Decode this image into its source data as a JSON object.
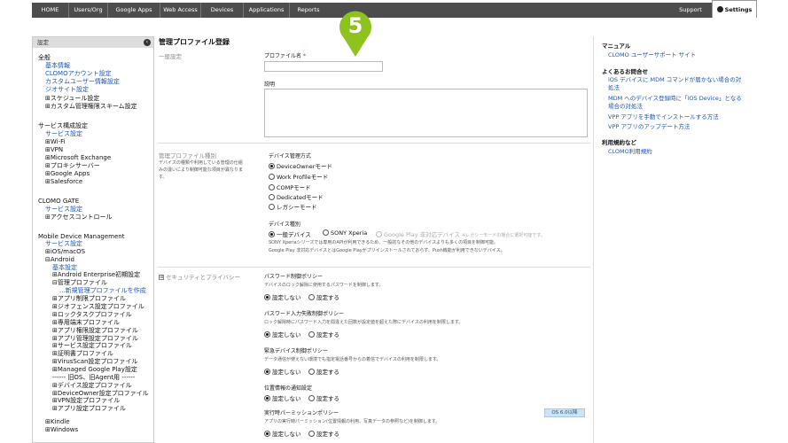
{
  "nav": {
    "items": [
      "HOME",
      "Users/Org",
      "Google Apps",
      "Web Access",
      "Devices",
      "Applications",
      "Reports"
    ],
    "support": "Support",
    "settings": "Settings"
  },
  "sidebar": {
    "header": "設定",
    "lines": [
      {
        "text": "全般",
        "kind": "sec"
      },
      {
        "text": "基本情報",
        "kind": "lnk"
      },
      {
        "text": "CLOMOアカウント設定",
        "kind": "lnk"
      },
      {
        "text": "カスタムユーザー情報設定",
        "kind": "lnk"
      },
      {
        "text": "ジオサイト設定",
        "kind": "lnk"
      },
      {
        "text": "⊞スケジュール設定",
        "kind": "plain"
      },
      {
        "text": "⊞カスタム管理権限スキーム設定",
        "kind": "plain"
      },
      {
        "text": "サービス構成設定",
        "kind": "sec"
      },
      {
        "text": "サービス設定",
        "kind": "lnk"
      },
      {
        "text": "⊞Wi-Fi",
        "kind": "plain"
      },
      {
        "text": "⊞VPN",
        "kind": "plain"
      },
      {
        "text": "⊞Microsoft Exchange",
        "kind": "plain"
      },
      {
        "text": "⊞プロキシサーバー",
        "kind": "plain"
      },
      {
        "text": "⊞Google Apps",
        "kind": "plain"
      },
      {
        "text": "⊞Salesforce",
        "kind": "plain"
      },
      {
        "text": "CLOMO GATE",
        "kind": "sec"
      },
      {
        "text": "サービス設定",
        "kind": "lnk"
      },
      {
        "text": "⊞アクセスコントロール",
        "kind": "plain"
      },
      {
        "text": "Mobile Device Management",
        "kind": "sec"
      },
      {
        "text": "サービス設定",
        "kind": "lnk"
      },
      {
        "text": "⊞iOS/macOS",
        "kind": "plain"
      },
      {
        "text": "⊟Android",
        "kind": "plain"
      },
      {
        "text": "基本設定",
        "kind": "lnk"
      },
      {
        "text": "⊞Android Enterprise初期設定",
        "kind": "plain"
      },
      {
        "text": "⊟管理プロファイル",
        "kind": "plain"
      },
      {
        "text": "...新規管理プロファイルを作成",
        "kind": "lnk"
      },
      {
        "text": "⊞アプリ制限プロファイル",
        "kind": "plain"
      },
      {
        "text": "⊞ジオフェンス設定プロファイル",
        "kind": "plain"
      },
      {
        "text": "⊞ロックタスクプロファイル",
        "kind": "plain"
      },
      {
        "text": "⊞専用端末プロファイル",
        "kind": "plain"
      },
      {
        "text": "⊞アプリ権限設定プロファイル",
        "kind": "plain"
      },
      {
        "text": "⊞アプリ管理設定プロファイル",
        "kind": "plain"
      },
      {
        "text": "⊞サービス設定プロファイル",
        "kind": "plain"
      },
      {
        "text": "⊞証明書プロファイル",
        "kind": "plain"
      },
      {
        "text": "⊞VirusScan設定プロファイル",
        "kind": "plain"
      },
      {
        "text": "⊞Managed Google Play設定",
        "kind": "plain"
      },
      {
        "text": "------ 旧OS、旧Agent用 ------",
        "kind": "plain"
      },
      {
        "text": "⊞デバイス設定プロファイル",
        "kind": "plain"
      },
      {
        "text": "⊞DeviceOwner設定プロファイル",
        "kind": "plain"
      },
      {
        "text": "⊞VPN設定プロファイル",
        "kind": "plain"
      },
      {
        "text": "⊞アプリ設定プロファイル",
        "kind": "plain"
      },
      {
        "text": "⊞Kindle",
        "kind": "plain"
      },
      {
        "text": "⊞Windows",
        "kind": "plain"
      }
    ]
  },
  "main": {
    "title": "管理プロファイル登録",
    "marker": "5",
    "general": {
      "section": "一般設定",
      "profile_name_label": "プロファイル名",
      "required": "*",
      "profile_name_value": "",
      "description_label": "説明",
      "description_value": ""
    },
    "type": {
      "section": "管理プロファイル種別",
      "section_desc_1": "デバイスの種類や利用している管理の仕組",
      "section_desc_2": "みの違いにより制御可能な項目が異なりま",
      "section_desc_3": "す。",
      "mgmt_label": "デバイス管理方式",
      "mgmt_options": [
        "DeviceOwnerモード",
        "Work Profileモード",
        "COMPモード",
        "Dedicatedモード",
        "レガシーモード"
      ],
      "device_label": "デバイス種別",
      "device_options": [
        "一般デバイス",
        "SONY Xperia",
        "Google Play 非対応デバイス"
      ],
      "device_note": "※レガシーモードの場合に選択可能です。",
      "note1": "SONY Xperiaシリーズでは専用のAPIが利用できるため、一般的なその他のデバイスよりも多くの項目を制御可能。",
      "note2": "Google Play 非対応デバイスとはGoogle Playがプリインストールされておらず、Push機能が利用できないデバイス。"
    },
    "security": {
      "section": "セキュリティとプライバシー",
      "expander": "⊞",
      "set_off": "設定しない",
      "set_on": "設定する",
      "policies": [
        {
          "title": "パスワード制御ポリシー",
          "desc": "デバイスのロック解除に使用するパスワードを制御します。"
        },
        {
          "title": "パスワード入力失敗制御ポリシー",
          "desc": "ロック解除時にパスワード入力を間違えた回数が設定値を超えた際にデバイスの利用を制限します。"
        },
        {
          "title": "緊急デバイス制御ポリシー",
          "desc": "データ通信が使えない環境でも指定電話番号からの着信でデバイスの利用を制限します。"
        },
        {
          "title": "位置情報の通知設定",
          "desc": ""
        },
        {
          "title": "実行時パーミッションポリシー",
          "desc": "アプリの実行時パーミッション(位置情報の利用、写真データの参照など)を制御します。",
          "badge": "OS 6.0以降"
        }
      ]
    }
  },
  "right": {
    "manual_heading": "マニュアル",
    "manual_link": "CLOMO ユーザーサポート サイト",
    "faq_heading": "よくあるお問合せ",
    "faq_links": [
      "iOS デバイスに MDM コマンドが届かない場合の対",
      "処法",
      "MDM へのデバイス登録時に「iOS Device」となる",
      "場合の対処法",
      "VPP アプリを手動でインストールする方法",
      "VPP アプリのアップデート方法"
    ],
    "terms_heading": "利用規約など",
    "terms_link": "CLOMO利用規約"
  },
  "colors": {
    "nav_bg": "#4d4d4d",
    "marker": "#8dc21f",
    "link": "#1a56b8"
  }
}
